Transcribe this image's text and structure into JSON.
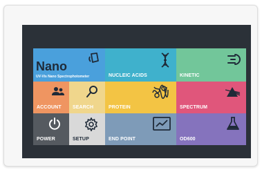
{
  "app": {
    "brand_name": "Nano",
    "brand_subtitle": "UV-Vis Nano Spectrophotometer"
  },
  "tiles": {
    "nucleic_acids": {
      "label": "NUCLEIC ACIDS",
      "icon": "dna-icon",
      "color": "#3fb1cc"
    },
    "kinetic": {
      "label": "KINETIC",
      "icon": "speedometer-arrow-icon",
      "color": "#72c69a"
    },
    "account": {
      "label": "ACCOUNT",
      "icon": "users-icon",
      "color": "#ef9561"
    },
    "search": {
      "label": "SEARCH",
      "icon": "magnifier-icon",
      "color": "#f0d68c"
    },
    "protein": {
      "label": "PROTEIN",
      "icon": "protein-structure-icon",
      "color": "#f3c444"
    },
    "spectrum": {
      "label": "SPECTRUM",
      "icon": "prism-icon",
      "color": "#e0567b"
    },
    "power": {
      "label": "POWER",
      "icon": "power-icon",
      "color": "#555a60"
    },
    "setup": {
      "label": "SETUP",
      "icon": "gear-icon",
      "color": "#d9d9d9"
    },
    "end_point": {
      "label": "END POINT",
      "icon": "chart-monitor-icon",
      "color": "#7e9bb8"
    },
    "od600": {
      "label": "OD600",
      "icon": "flask-icon",
      "color": "#8573bd"
    },
    "brand": {
      "icon": "cuvette-icon",
      "color": "#4aa0dc"
    }
  }
}
